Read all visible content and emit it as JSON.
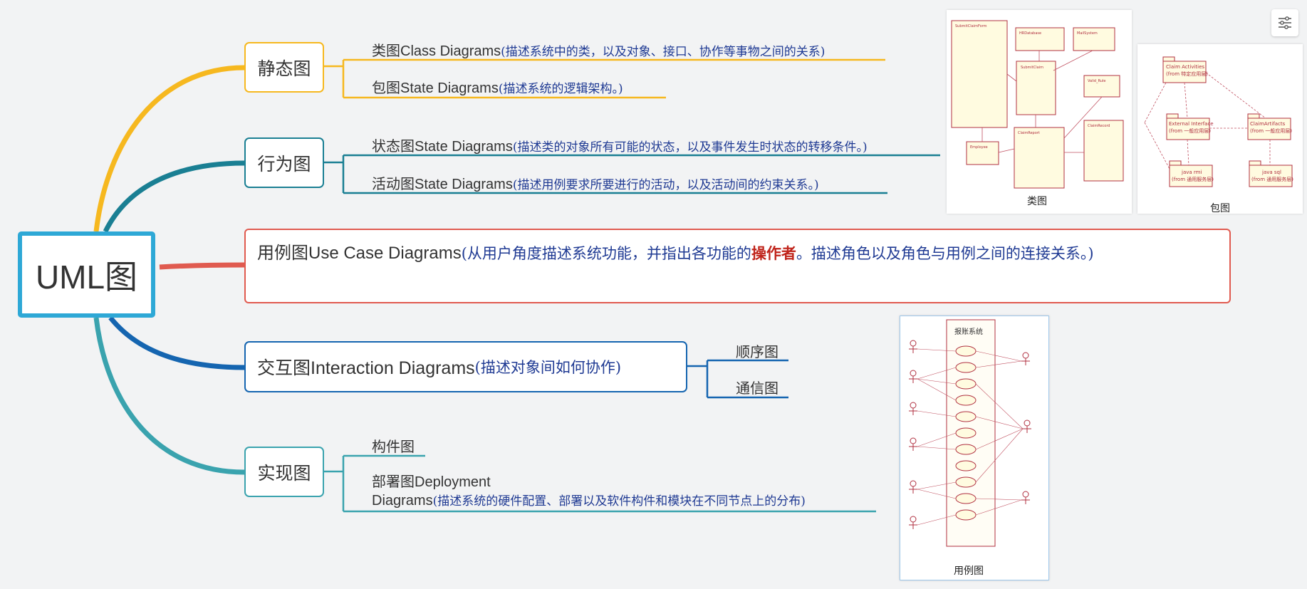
{
  "root": {
    "label": "UML图"
  },
  "branches": {
    "static": {
      "label": "静态图",
      "items": [
        {
          "title": "类图Class Diagrams",
          "desc": "(描述系统中的类，以及对象、接口、协作等事物之间的关系)"
        },
        {
          "title": "包图State Diagrams",
          "desc": "(描述系统的逻辑架构。)"
        }
      ]
    },
    "behavior": {
      "label": "行为图",
      "items": [
        {
          "title": "状态图State Diagrams",
          "desc": "(描述类的对象所有可能的状态，以及事件发生时状态的转移条件。)"
        },
        {
          "title": "活动图State Diagrams",
          "desc": "(描述用例要求所要进行的活动，以及活动间的约束关系。)"
        }
      ]
    },
    "usecase": {
      "title": "用例图Use Case Diagrams",
      "desc_part1": "(从用户角度描述系统功能，并指出各功能的",
      "highlight": "操作者",
      "desc_part2": "。描述角色以及角色与用例之间的连接关系。)"
    },
    "interaction": {
      "title": "交互图Interaction Diagrams",
      "desc": "(描述对象间如何协作)",
      "items": [
        "顺序图",
        "通信图"
      ]
    },
    "implementation": {
      "label": "实现图",
      "items": [
        {
          "title": "构件图"
        },
        {
          "title_line1": "部署图Deployment",
          "title_line2": "Diagrams",
          "desc": "(描述系统的硬件配置、部署以及软件构件和模块在不同节点上的分布)"
        }
      ]
    }
  },
  "images": {
    "class_diagram": {
      "caption": "类图"
    },
    "package_diagram": {
      "caption": "包图",
      "packages": [
        {
          "name": "Claim Activities",
          "from": "(from 特定应用层)"
        },
        {
          "name": "External Interface",
          "from": "(from 一般应用层)"
        },
        {
          "name": "ClaimArtifacts",
          "from": "(from 一般应用层)"
        },
        {
          "name": "java rmi",
          "from": "(from 通用服务层)"
        },
        {
          "name": "java sql",
          "from": "(from 通用服务层)"
        }
      ]
    },
    "usecase_diagram": {
      "caption": "用例图",
      "system": "报账系统"
    }
  },
  "colors": {
    "static": "#f6b81f",
    "behavior": "#1a7f93",
    "usecase": "#e05a4f",
    "interaction": "#1565b0",
    "implementation": "#3aa3ae",
    "root": "#2ea8d6"
  },
  "icons": {
    "toolbar": "sliders-icon"
  }
}
